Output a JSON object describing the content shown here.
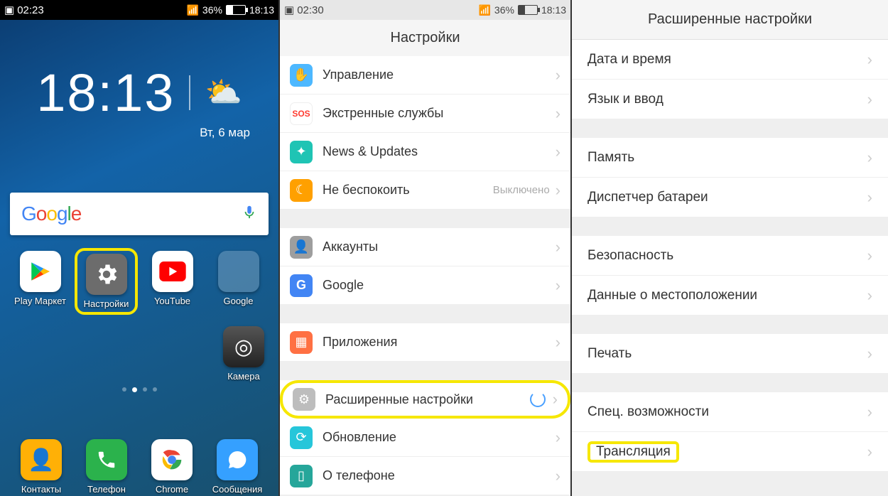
{
  "home": {
    "status": {
      "rec": "02:23",
      "battery_pct": "36%",
      "time": "18:13"
    },
    "clock_time": "18:13",
    "clock_date": "Вт, 6 мар",
    "search_logo": "Google",
    "apps": {
      "play": "Play Маркет",
      "settings": "Настройки",
      "youtube": "YouTube",
      "google": "Google",
      "camera": "Камера"
    },
    "dock": {
      "contacts": "Контакты",
      "phone": "Телефон",
      "chrome": "Chrome",
      "messages": "Сообщения"
    }
  },
  "settings": {
    "status": {
      "rec": "02:30",
      "battery_pct": "36%",
      "time": "18:13"
    },
    "title": "Настройки",
    "rows": {
      "control": "Управление",
      "sos": "Экстренные службы",
      "news": "News & Updates",
      "dnd": "Не беспокоить",
      "dnd_value": "Выключено",
      "accounts": "Аккаунты",
      "google": "Google",
      "apps": "Приложения",
      "advanced": "Расширенные настройки",
      "update": "Обновление",
      "about": "О телефоне"
    }
  },
  "advanced": {
    "title": "Расширенные настройки",
    "rows": {
      "datetime": "Дата и время",
      "lang": "Язык и ввод",
      "memory": "Память",
      "battery": "Диспетчер батареи",
      "security": "Безопасность",
      "location": "Данные о местоположении",
      "print": "Печать",
      "access": "Спец. возможности",
      "cast": "Трансляция"
    }
  }
}
